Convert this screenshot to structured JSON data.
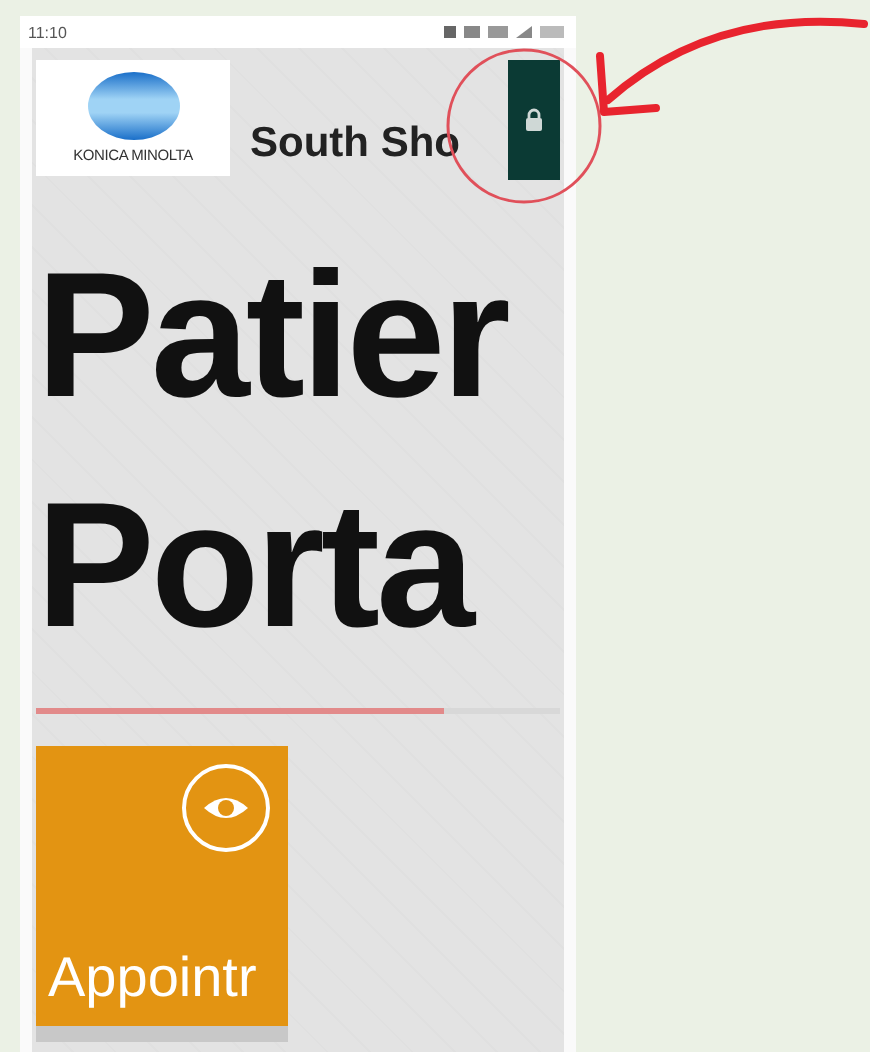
{
  "status_bar": {
    "time": "11:10"
  },
  "header": {
    "logo_text": "KONICA MINOLTA",
    "title": "South Sho"
  },
  "heading": {
    "lines": [
      "Patier",
      "Porta"
    ]
  },
  "progress": {
    "level": 0.78
  },
  "tiles": [
    {
      "label": "Appointr"
    }
  ]
}
